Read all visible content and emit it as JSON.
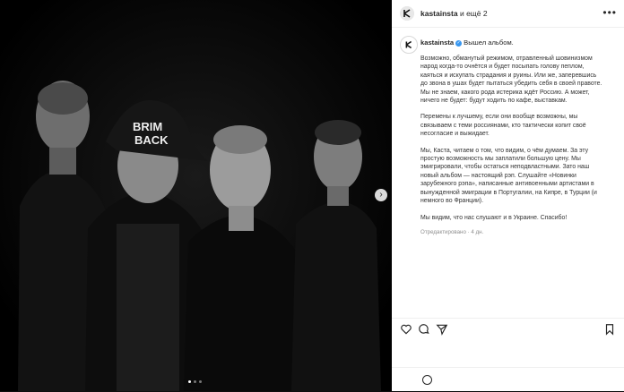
{
  "header": {
    "username": "kastainsta",
    "and_more": " и ещё 2",
    "more_glyph": "•••"
  },
  "photo": {
    "cap_text_line1": "BRIM",
    "cap_text_line2": "BACK",
    "next_arrow_glyph": "›",
    "slides": 3,
    "active_slide": 1
  },
  "caption": {
    "username": "kastainsta",
    "verified_glyph": "✓",
    "first_line": "Вышел альбом.",
    "paragraphs": [
      "Возможно, обманутый режимом, отравленный шовинизмом\nнарод когда-то очнётся и будет посыпать голову пеплом,\nкаяться и искупать страдания и руины. Или же, заперевшись\nдо звона в ушах будет пытаться убедить себя в своей правоте.\nМы не знаем, какого рода истерика ждёт Россию. А может,\nничего не будет: будут ходить по кафе, выставкам.",
      "Перемены к лучшему, если они вообще возможны, мы\nсвязываем с теми россиянами, кто тактически копит своё\nнесогласие и выжидает.",
      "Мы, Каста, читаем о том, что видим, о чём думаем. За эту\nпростую возможность мы заплатили большую цену. Мы\nэмигрировали, чтобы остаться неподвластными. Зато наш\nновый альбом — настоящий рэп. Слушайте «Новинки\nзарубежного рэпа», написанные антивоенными артистами в\nвынужденной эмиграции в Португалии, на Кипре, в Турции (и\nнемного во Франции).",
      "Мы видим, что нас слушают и в Украине. Спасибо!"
    ],
    "edited_time": "Отредактировано · 4 дн."
  },
  "comment": {
    "placeholder": "",
    "post_label": ""
  }
}
